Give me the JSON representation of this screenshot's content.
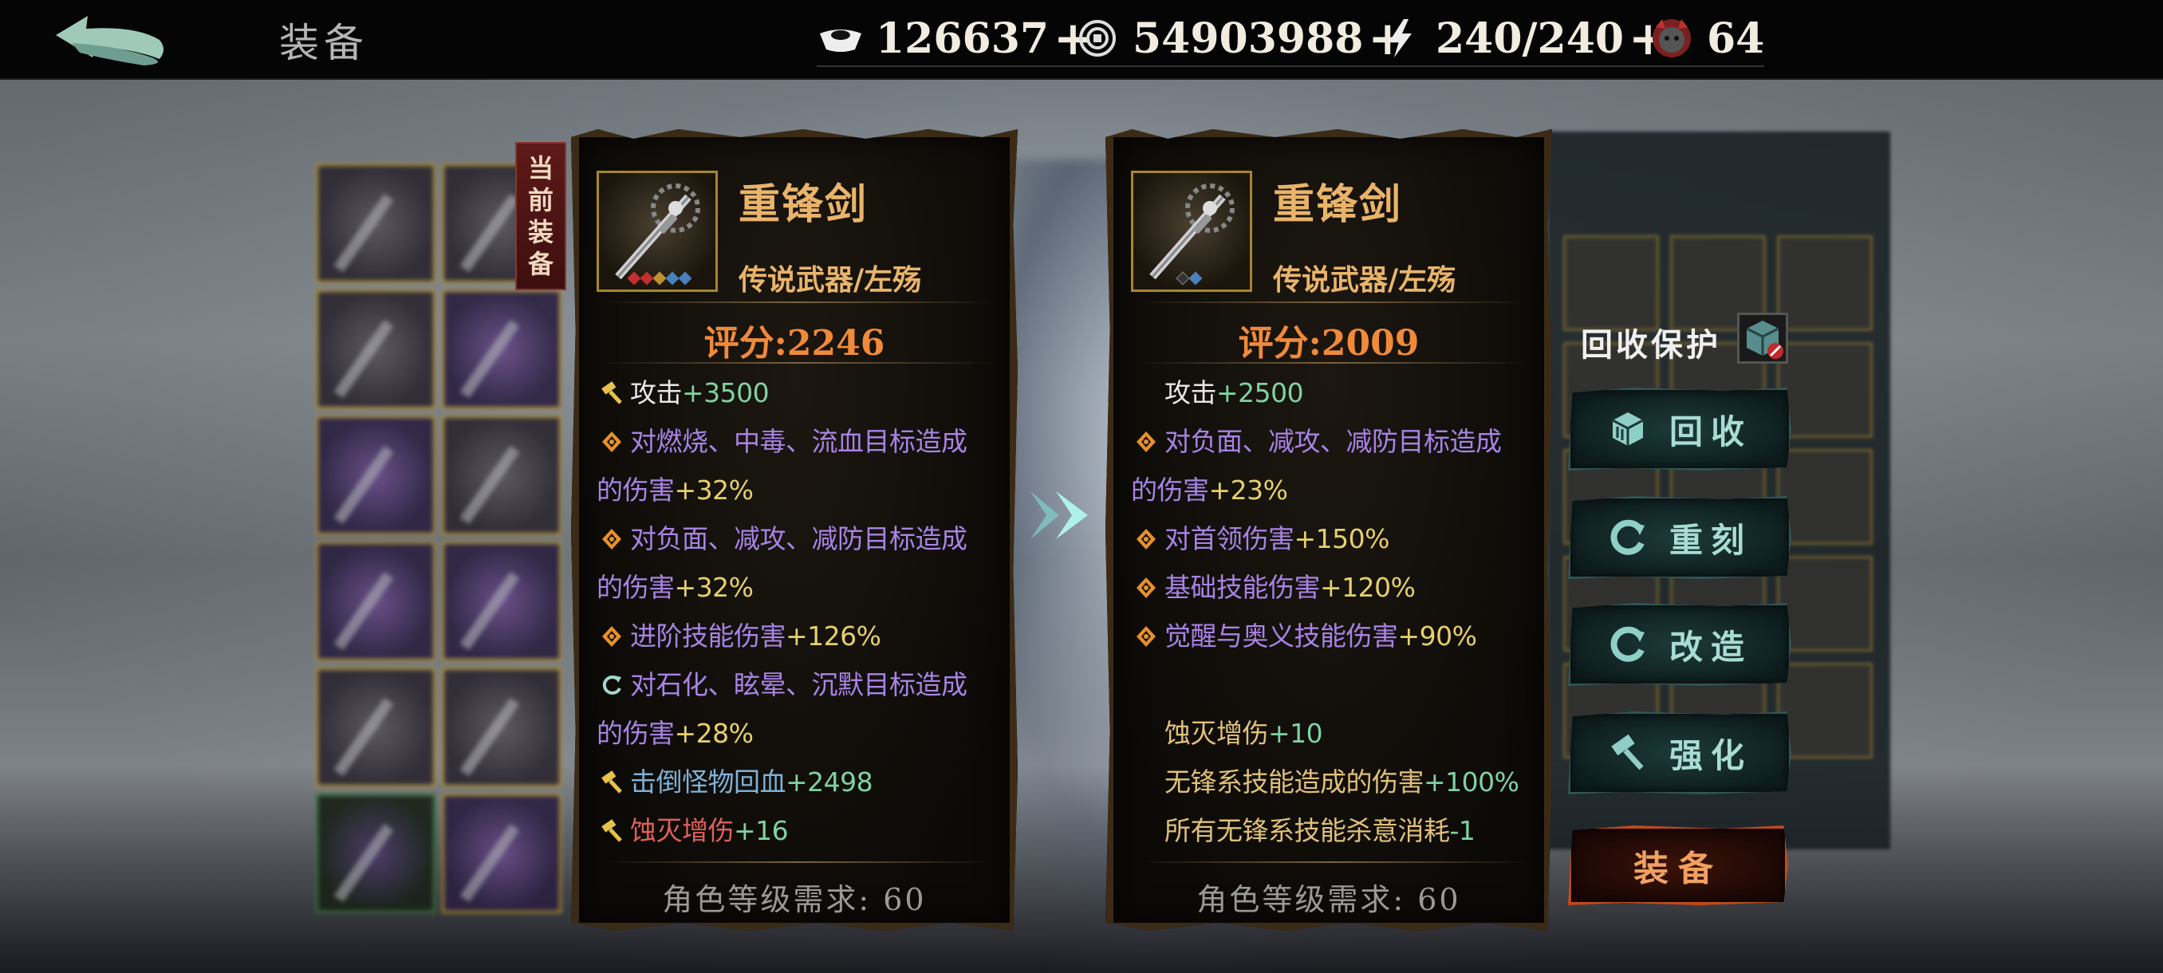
{
  "header": {
    "title": "装备",
    "resources": [
      {
        "icon": "silver-ingot-icon",
        "value": "126637",
        "plus": "+"
      },
      {
        "icon": "coin-icon",
        "value": "54903988",
        "plus": "+"
      },
      {
        "icon": "lightning-icon",
        "value": "240/240",
        "plus": "+"
      },
      {
        "icon": "demon-mask-icon",
        "value": "64"
      }
    ]
  },
  "current_tag": [
    "当",
    "前",
    "装",
    "备"
  ],
  "current_item": {
    "name": "重锋剑",
    "type": "传说武器/左殇",
    "score": "评分:2246",
    "stats": [
      {
        "icon": "hammer-icon",
        "lines": [
          {
            "t": "攻击",
            "c": "plain"
          },
          {
            "t": "+3500",
            "c": "green"
          }
        ]
      },
      {
        "icon": "diamond-icon",
        "lines": [
          {
            "t": "对燃烧、中毒、流血目标造成",
            "c": "purple"
          }
        ],
        "cont": [
          {
            "t": "的伤害",
            "c": "purple"
          },
          {
            "t": "+32%",
            "c": "yellow"
          }
        ]
      },
      {
        "icon": "diamond-icon",
        "lines": [
          {
            "t": "对负面、减攻、减防目标造成",
            "c": "purple"
          }
        ],
        "cont": [
          {
            "t": "的伤害",
            "c": "purple"
          },
          {
            "t": "+32%",
            "c": "yellow"
          }
        ]
      },
      {
        "icon": "diamond-icon",
        "lines": [
          {
            "t": "进阶技能伤害",
            "c": "purple"
          },
          {
            "t": "+126%",
            "c": "yellow"
          }
        ]
      },
      {
        "icon": "refresh-icon",
        "lines": [
          {
            "t": "对石化、眩晕、沉默目标造成",
            "c": "purple"
          }
        ],
        "cont": [
          {
            "t": "的伤害",
            "c": "purple"
          },
          {
            "t": "+28%",
            "c": "yellow"
          }
        ]
      },
      {
        "icon": "hammer-icon",
        "lines": [
          {
            "t": "击倒怪物回血",
            "c": "blue"
          },
          {
            "t": "+2498",
            "c": "green"
          }
        ]
      },
      {
        "icon": "hammer-icon",
        "lines": [
          {
            "t": "蚀灭增伤",
            "c": "red"
          },
          {
            "t": "+16",
            "c": "green"
          }
        ]
      }
    ],
    "level_req": "角色等级需求: 60"
  },
  "compare_item": {
    "name": "重锋剑",
    "type": "传说武器/左殇",
    "score": "评分:2009",
    "stats": [
      {
        "icon": "",
        "lines": [
          {
            "t": "攻击",
            "c": "plain"
          },
          {
            "t": "+2500",
            "c": "green"
          }
        ]
      },
      {
        "icon": "diamond-icon",
        "lines": [
          {
            "t": "对负面、减攻、减防目标造成",
            "c": "purple"
          }
        ],
        "cont": [
          {
            "t": "的伤害",
            "c": "purple"
          },
          {
            "t": "+23%",
            "c": "yellow"
          }
        ]
      },
      {
        "icon": "diamond-icon",
        "lines": [
          {
            "t": "对首领伤害",
            "c": "purple"
          },
          {
            "t": "+150%",
            "c": "yellow"
          }
        ]
      },
      {
        "icon": "diamond-icon",
        "lines": [
          {
            "t": "基础技能伤害",
            "c": "purple"
          },
          {
            "t": "+120%",
            "c": "yellow"
          }
        ]
      },
      {
        "icon": "diamond-icon",
        "lines": [
          {
            "t": "觉醒与奥义技能伤害",
            "c": "purple"
          },
          {
            "t": "+90%",
            "c": "yellow"
          }
        ]
      },
      {
        "icon": "",
        "blank": true,
        "lines": []
      },
      {
        "icon": "",
        "lines": [
          {
            "t": "蚀灭增伤",
            "c": "gold"
          },
          {
            "t": "+10",
            "c": "green"
          }
        ]
      },
      {
        "icon": "",
        "lines": [
          {
            "t": "无锋系技能造成的伤害",
            "c": "gold"
          },
          {
            "t": "+100%",
            "c": "green"
          }
        ]
      },
      {
        "icon": "",
        "lines": [
          {
            "t": "所有无锋系技能杀意消耗",
            "c": "gold"
          },
          {
            "t": "-1",
            "c": "green"
          }
        ]
      }
    ],
    "level_req": "角色等级需求: 60"
  },
  "actions": {
    "recycle_protect": "回收保护",
    "buttons": [
      {
        "name": "recycle-button",
        "icon": "cube-icon",
        "label": "回收"
      },
      {
        "name": "reforge-button",
        "icon": "refresh-icon",
        "label": "重刻"
      },
      {
        "name": "modify-button",
        "icon": "refresh-icon",
        "label": "改造"
      },
      {
        "name": "enhance-button",
        "icon": "hammer-icon",
        "label": "强化"
      }
    ],
    "equip": "装备"
  },
  "colors": {
    "gold_name": "#e9b46a",
    "score": "#f08a3a",
    "purple_stat": "#a883e6",
    "green_num": "#7fd2a2",
    "yellow_num": "#e6d06a",
    "equip_border": "#c04a1a"
  }
}
